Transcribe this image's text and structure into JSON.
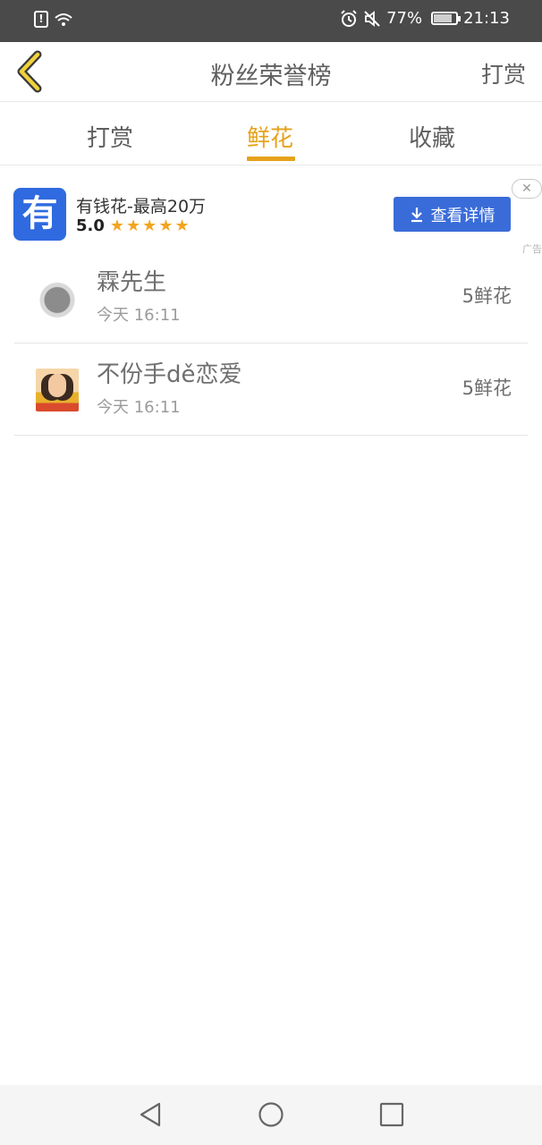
{
  "status_bar": {
    "battery_percent": "77%",
    "battery_level": 0.77,
    "time": "21:13",
    "icons": [
      "alert-icon",
      "wifi-icon",
      "alarm-icon",
      "mute-icon",
      "battery-icon"
    ]
  },
  "header": {
    "title": "粉丝荣誉榜",
    "action_label": "打赏",
    "back_icon": "chevron-left-icon",
    "accent_color": "#e6a21b"
  },
  "tabs": [
    {
      "label": "打赏",
      "active": false
    },
    {
      "label": "鲜花",
      "active": true
    },
    {
      "label": "收藏",
      "active": false
    }
  ],
  "ad": {
    "logo_text": "有",
    "title": "有钱花-最高20万",
    "rating": "5.0",
    "stars": 5,
    "cta_label": "查看详情",
    "cta_color": "#3a6cd9",
    "close_glyph": "✕",
    "badge": "广告"
  },
  "list": [
    {
      "name": "霖先生",
      "time": "今天 16:11",
      "amount": "5鲜花"
    },
    {
      "name": "不份手dě恋爱",
      "time": "今天 16:11",
      "amount": "5鲜花"
    }
  ],
  "nav_bar": {
    "icons": [
      "back-triangle-icon",
      "home-circle-icon",
      "recents-square-icon"
    ]
  }
}
